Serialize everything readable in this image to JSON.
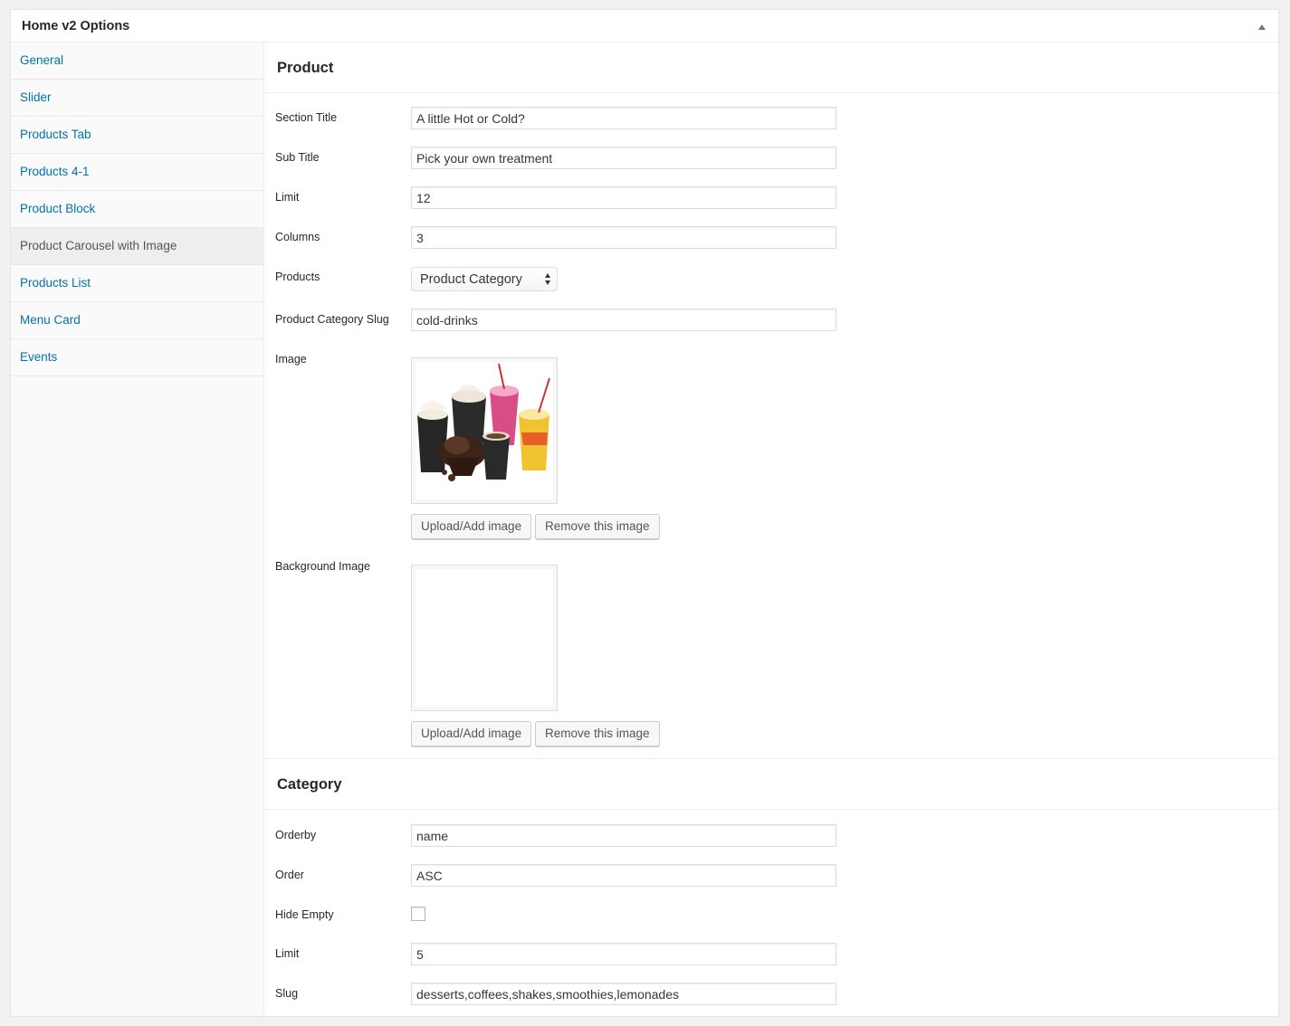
{
  "panel": {
    "title": "Home v2 Options",
    "toggle_icon": "triangle-up-icon"
  },
  "sidebar": {
    "items": [
      {
        "label": "General",
        "active": false
      },
      {
        "label": "Slider",
        "active": false
      },
      {
        "label": "Products Tab",
        "active": false
      },
      {
        "label": "Products 4-1",
        "active": false
      },
      {
        "label": "Product Block",
        "active": false
      },
      {
        "label": "Product Carousel with Image",
        "active": true
      },
      {
        "label": "Products List",
        "active": false
      },
      {
        "label": "Menu Card",
        "active": false
      },
      {
        "label": "Events",
        "active": false
      }
    ]
  },
  "product": {
    "heading": "Product",
    "section_title": {
      "label": "Section Title",
      "value": "A little Hot or Cold?"
    },
    "sub_title": {
      "label": "Sub Title",
      "value": "Pick your own treatment"
    },
    "limit": {
      "label": "Limit",
      "value": "12"
    },
    "columns": {
      "label": "Columns",
      "value": "3"
    },
    "products": {
      "label": "Products",
      "selected": "Product Category"
    },
    "category_slug": {
      "label": "Product Category Slug",
      "value": "cold-drinks"
    },
    "image": {
      "label": "Image",
      "upload_label": "Upload/Add image",
      "remove_label": "Remove this image"
    },
    "background_image": {
      "label": "Background Image",
      "upload_label": "Upload/Add image",
      "remove_label": "Remove this image"
    }
  },
  "category": {
    "heading": "Category",
    "orderby": {
      "label": "Orderby",
      "value": "name"
    },
    "order": {
      "label": "Order",
      "value": "ASC"
    },
    "hide_empty": {
      "label": "Hide Empty",
      "checked": false
    },
    "limit": {
      "label": "Limit",
      "value": "5"
    },
    "slug": {
      "label": "Slug",
      "value": "desserts,coffees,shakes,smoothies,lemonades"
    }
  },
  "colors": {
    "link": "#0073aa",
    "border": "#e5e5e5",
    "active_bg": "#eeeeee"
  }
}
